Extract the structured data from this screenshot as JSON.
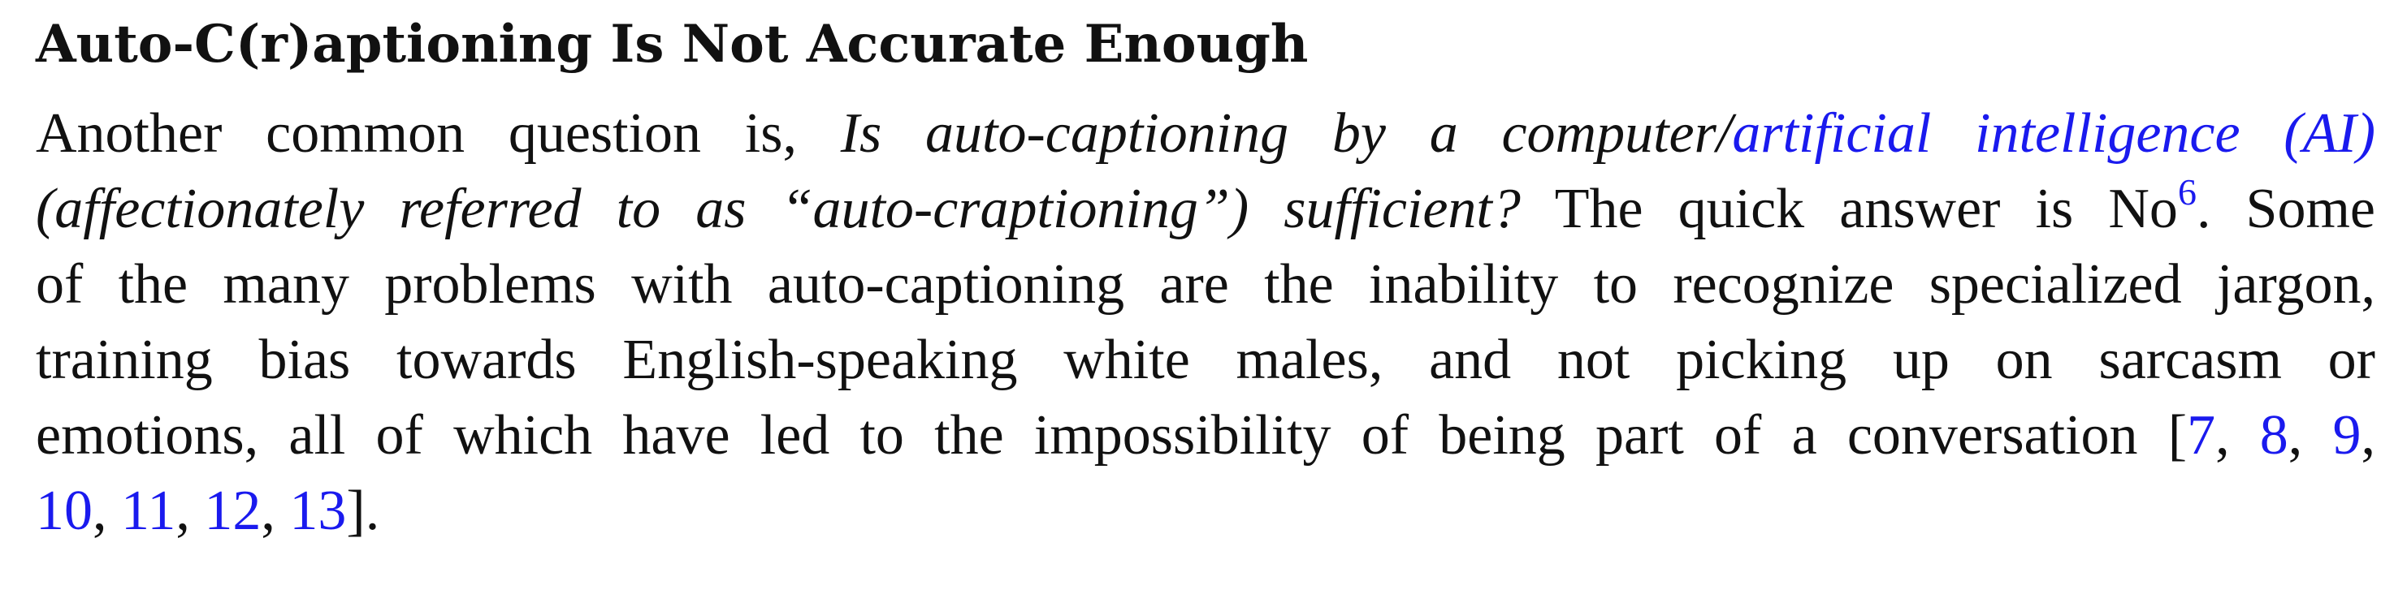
{
  "heading": "Auto-C(r)aptioning Is Not Accurate Enough",
  "paragraph": {
    "intro": "Another common question is,",
    "question_part1": "Is auto-captioning by a computer/",
    "ai_link": "artificial intelligence (AI)",
    "question_part2": "(affectionately referred to as “auto-craptioning”) sufficient?",
    "answer": "The quick answer is No",
    "footnote_marker": "6",
    "after_answer": ". Some",
    "line3": "of the many problems with auto-captioning are the inability to recognize specialized jargon,",
    "line4": "training bias towards English-speaking white males, and not picking up on sarcasm or",
    "line5": "emotions, all of which have led to the impossibility of being part of a conversation [",
    "closing": "]."
  },
  "citations": [
    "7",
    "8",
    "9",
    "10",
    "11",
    "12",
    "13"
  ],
  "colors": {
    "text": "#111111",
    "link": "#1a1aee",
    "background": "#ffffff"
  }
}
